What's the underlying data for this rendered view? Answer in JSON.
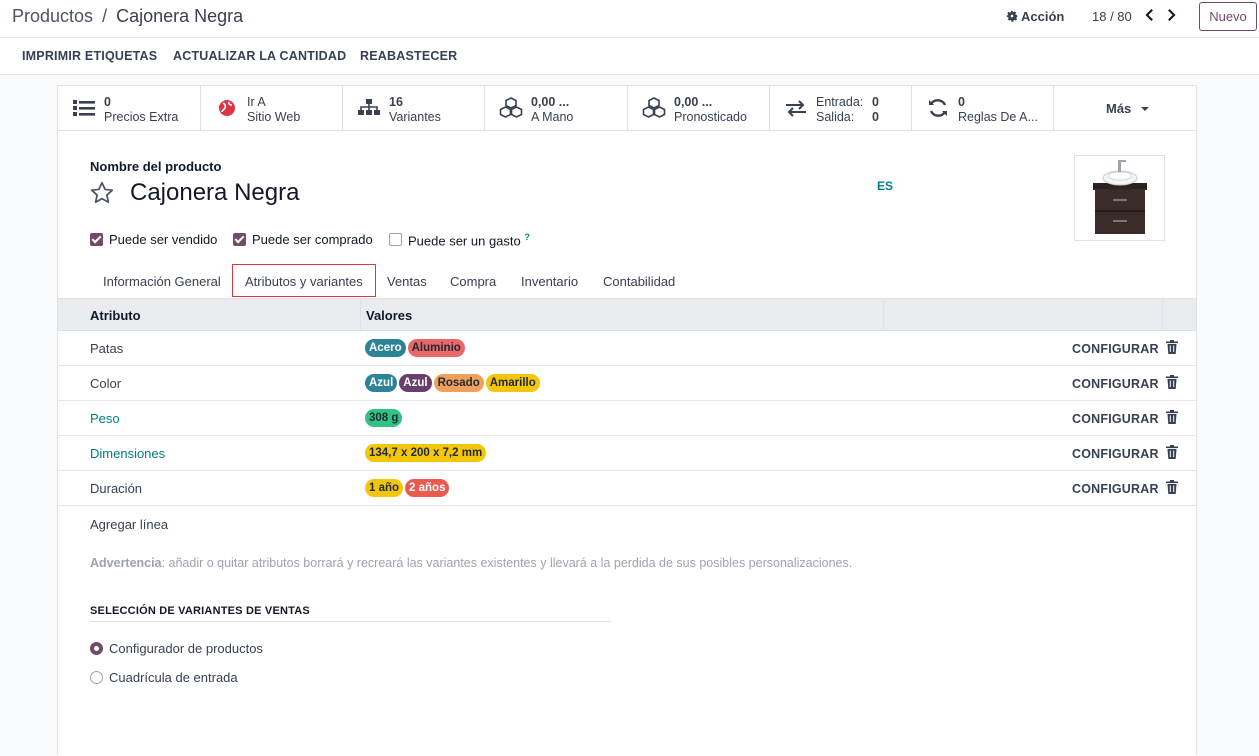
{
  "breadcrumb": {
    "parent": "Productos",
    "separator": "/",
    "current": "Cajonera Negra"
  },
  "header": {
    "action_label": "Acción",
    "pager": "18 / 80",
    "new_label": "Nuevo"
  },
  "actions": [
    "IMPRIMIR ETIQUETAS",
    "ACTUALIZAR LA CANTIDAD",
    "REABASTECER"
  ],
  "stats": {
    "precios": {
      "value": "0",
      "label": "Precios Extra"
    },
    "web": {
      "value": "Ir A",
      "label": "Sitio Web"
    },
    "variantes": {
      "value": "16",
      "label": "Variantes"
    },
    "mano": {
      "value": "0,00 ...",
      "label": "A Mano"
    },
    "pronosticado": {
      "value": "0,00 ...",
      "label": "Pronosticado"
    },
    "entrada_label": "Entrada:",
    "entrada_value": "0",
    "salida_label": "Salida:",
    "salida_value": "0",
    "reglas": {
      "value": "0",
      "label": "Reglas De A..."
    },
    "more_label": "Más"
  },
  "product": {
    "field_label": "Nombre del producto",
    "name": "Cajonera Negra",
    "lang": "ES",
    "checkboxes": {
      "vendido": "Puede ser vendido",
      "comprado": "Puede ser comprado",
      "gasto": "Puede ser un gasto",
      "gasto_help": "?"
    }
  },
  "tabs": [
    "Información General",
    "Atributos y variantes",
    "Ventas",
    "Compra",
    "Inventario",
    "Contabilidad"
  ],
  "table": {
    "headers": {
      "attr": "Atributo",
      "vals": "Valores"
    },
    "configure_label": "CONFIGURAR",
    "rows": [
      {
        "name": "Patas",
        "values": [
          "Acero",
          "Aluminio"
        ]
      },
      {
        "name": "Color",
        "values": [
          "Azul",
          "Azul",
          "Rosado",
          "Amarillo"
        ]
      },
      {
        "name": "Peso",
        "values": [
          "308 g"
        ]
      },
      {
        "name": "Dimensiones",
        "values": [
          "134,7 x 200 x 7,2 mm"
        ]
      },
      {
        "name": "Duración",
        "values": [
          "1 año",
          "2 años"
        ]
      }
    ],
    "add_line": "Agregar línea"
  },
  "warning": {
    "label": "Advertencia",
    "text": ": añadir o quitar atributos borrará y recreará las variantes existentes y llevará a la perdida de sus posibles personalizaciones."
  },
  "sales_section": {
    "title": "SELECCIÓN DE VARIANTES DE VENTAS",
    "option1": "Configurador de productos",
    "option2": "Cuadrícula de entrada"
  },
  "colors": {
    "brand": "#714b67",
    "link": "#017e84",
    "badge_teal": "#2c8397",
    "badge_red": "#e86869",
    "badge_purple": "#6a3e6a",
    "badge_orange": "#f0a05a",
    "badge_yellow": "#f4c609",
    "badge_green": "#30c381",
    "badge_coral": "#ea5a4f"
  }
}
